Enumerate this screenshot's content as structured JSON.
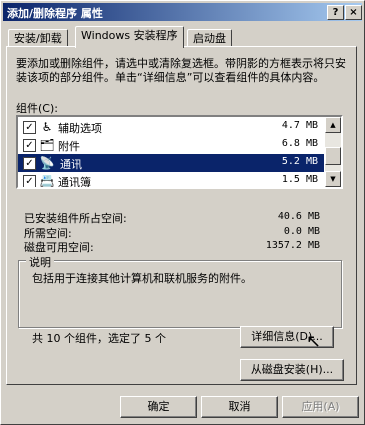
{
  "window": {
    "title": "添加/删除程序 属性",
    "help_btn": "?",
    "close_btn": "×"
  },
  "tabs": [
    {
      "label": "安装/卸载",
      "active": false
    },
    {
      "label": "Windows 安装程序",
      "active": true
    },
    {
      "label": "启动盘",
      "active": false
    }
  ],
  "description": "要添加或删除组件，请选中或清除复选框。带阴影的方框表示将只安装该项的部分组件。单击“详细信息”可以查看组件的具体内容。",
  "components_label": "组件(C):",
  "components": [
    {
      "icon": "accessibility-icon",
      "glyph": "♿",
      "name": "辅助选项",
      "size": "4.7 MB",
      "checked": true,
      "selected": false
    },
    {
      "icon": "accessories-icon",
      "glyph": "🗂",
      "name": "附件",
      "size": "6.8 MB",
      "checked": true,
      "selected": false
    },
    {
      "icon": "communications-icon",
      "glyph": "📡",
      "name": "通讯",
      "size": "5.2 MB",
      "checked": true,
      "selected": true
    },
    {
      "icon": "address-book-icon",
      "glyph": "📇",
      "name": "通讯簿",
      "size": "1.5 MB",
      "checked": true,
      "selected": false
    }
  ],
  "stats": {
    "installed_label": "已安装组件所占空间:",
    "installed_value": "40.6 MB",
    "required_label": "所需空间:",
    "required_value": "0.0 MB",
    "free_label": "磁盘可用空间:",
    "free_value": "1357.2 MB"
  },
  "group": {
    "title": "说明",
    "text": "包括用于连接其他计算机和联机服务的附件。",
    "summary": "共 10 个组件，选定了 5 个"
  },
  "buttons": {
    "details": "详细信息(D)...",
    "have_disk": "从磁盘安装(H)...",
    "ok": "确定",
    "cancel": "取消",
    "apply": "应用(A)"
  }
}
